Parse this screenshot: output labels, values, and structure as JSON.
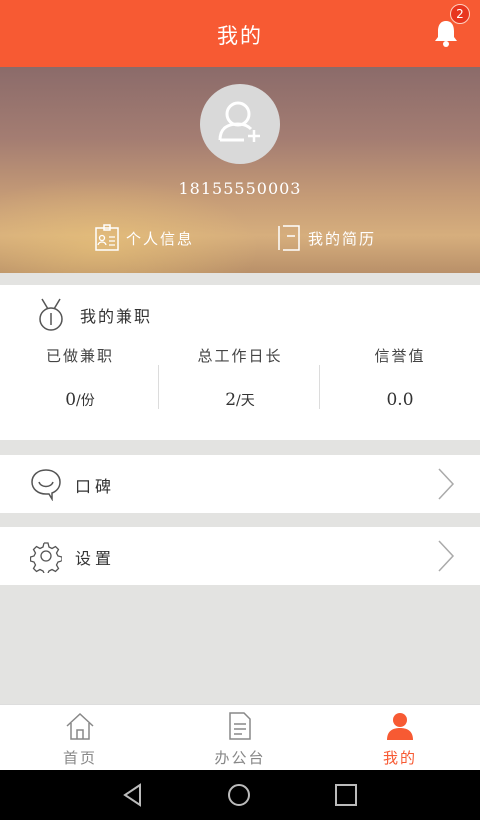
{
  "header": {
    "title": "我的",
    "notification_count": "2"
  },
  "profile": {
    "phone": "18155550003",
    "links": {
      "info": "个人信息",
      "resume": "我的简历"
    }
  },
  "jianzhi": {
    "title": "我的兼职",
    "stats": [
      {
        "label": "已做兼职",
        "value": "0",
        "unit": "/份"
      },
      {
        "label": "总工作日长",
        "value": "2",
        "unit": "/天"
      },
      {
        "label": "信誉值",
        "value": "0.0",
        "unit": ""
      }
    ]
  },
  "menu": {
    "koubei": "口碑",
    "settings": "设置"
  },
  "tabs": [
    {
      "label": "首页"
    },
    {
      "label": "办公台"
    },
    {
      "label": "我的"
    }
  ],
  "colors": {
    "accent": "#f75a33",
    "tab_inactive": "#888888"
  }
}
